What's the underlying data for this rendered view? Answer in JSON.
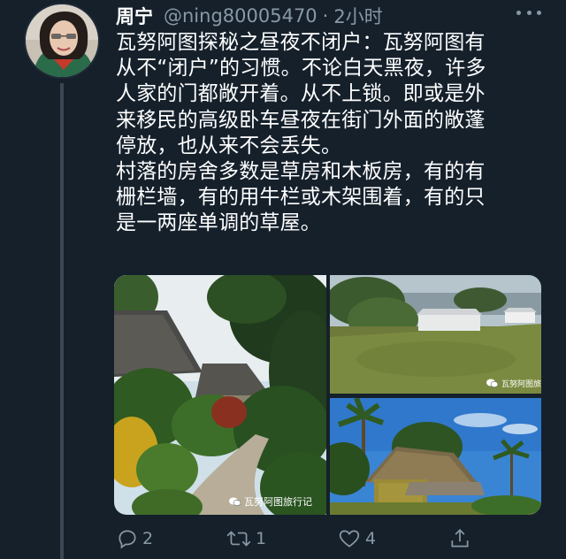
{
  "tweet": {
    "author_name": "周宁",
    "handle": "@ning80005470",
    "separator": "·",
    "time": "2小时",
    "more_icon": "more-horizontal-icon",
    "lines": [
      "瓦努阿图探秘之昼夜不闭户：瓦努阿图有",
      "从不“闭户”的习惯。不论白天黑夜，许多",
      "人家的门都敞开着。从不上锁。即或是外",
      "来移民的高级卧车昼夜在街门外面的敞蓬",
      "停放，也从来不会丢失。",
      "村落的房舍多数是草房和木板房，有的有",
      "栅栏墙，有的用牛栏或木架围着，有的只",
      "是一两座单调的草屋。"
    ]
  },
  "media": {
    "watermark_left": "瓦努阿图旅行记",
    "watermark_top_right": "瓦努阿图旅行记"
  },
  "actions": {
    "reply": {
      "icon": "reply-icon",
      "count": "2"
    },
    "retweet": {
      "icon": "retweet-icon",
      "count": "1"
    },
    "like": {
      "icon": "heart-icon",
      "count": "4"
    },
    "share": {
      "icon": "share-icon"
    }
  },
  "colors": {
    "background": "#15202b",
    "text": "#ffffff",
    "muted": "#8899a6"
  }
}
